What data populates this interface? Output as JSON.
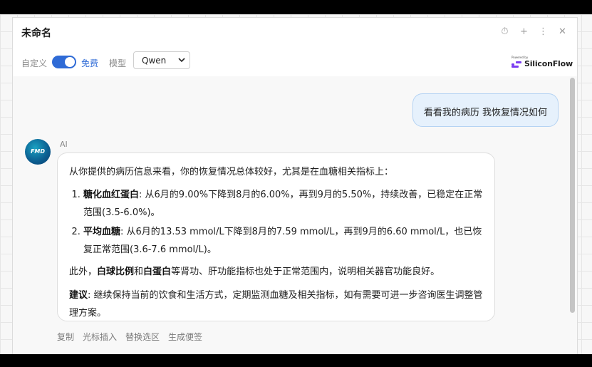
{
  "window": {
    "title": "未命名",
    "icons": [
      "timer-icon",
      "plus-icon",
      "more-vertical-icon",
      "close-icon"
    ]
  },
  "toolbar": {
    "custom_label": "自定义",
    "toggle_on": true,
    "free_label": "免费",
    "model_label": "模型",
    "model_value": "Qwen"
  },
  "logo": {
    "powered_by": "Powered by",
    "name": "SiliconFlow",
    "accent": "#7a3cf0"
  },
  "chat": {
    "user_message": "看看我的病历 我恢复情况如何",
    "ai_label": "AI",
    "avatar_text": "FMD",
    "ai_intro": "从你提供的病历信息来看，你的恢复情况总体较好，尤其是在血糖相关指标上：",
    "items": [
      {
        "bold": "糖化血红蛋白",
        "text": ": 从6月的9.00%下降到8月的6.00%，再到9月的5.50%，持续改善，已稳定在正常范围(3.5-6.0%)。"
      },
      {
        "bold": "平均血糖",
        "text": ": 从6月的13.53 mmol/L下降到8月的7.59 mmol/L，再到9月的6.60 mmol/L，也已恢复正常范围(3.6-7.6 mmol/L)。"
      }
    ],
    "extra": {
      "prefix": "此外，",
      "bold1": "白球比例",
      "mid": "和",
      "bold2": "白蛋白",
      "suffix": "等肾功、肝功能指标也处于正常范围内，说明相关器官功能良好。"
    },
    "advice": {
      "bold": "建议",
      "text": ": 继续保持当前的饮食和生活方式，定期监测血糖及相关指标，如有需要可进一步咨询医生调整管理方案。"
    },
    "actions": [
      "复制",
      "光标插入",
      "替换选区",
      "生成便签"
    ]
  },
  "colors": {
    "accent": "#2f6bd6",
    "user_bubble": "#e6f1fc"
  }
}
